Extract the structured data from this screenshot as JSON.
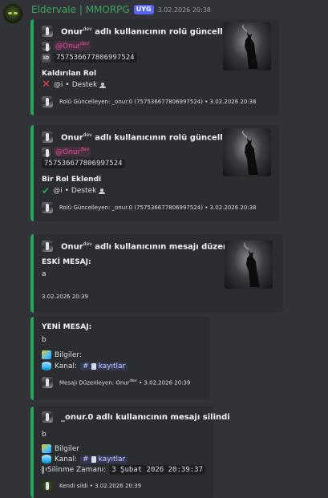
{
  "header": {
    "author": "Eldervale | MMORPG",
    "tag": "UYG",
    "timestamp": "3.02.2026 20:38"
  },
  "embed1": {
    "title": "Onur",
    "title_sup": "dev",
    "title_rest": "adlı kullanıcının rolü güncellendi",
    "mention": "@Onur",
    "mention_sup": "dev",
    "id_badge": "ID",
    "user_id": "757536677806997524",
    "field_name": "Kaldırılan Rol",
    "role_prefix": "@i",
    "role_name": "Destek",
    "footer": "Rolü Güncelleyen: _onur.0 (757536677806997524) • 3.02.2026 20:38"
  },
  "embed2": {
    "title": "Onur",
    "title_sup": "dev",
    "title_rest": "adlı kullanıcının rolü güncellendi",
    "mention": "@Onur",
    "mention_sup": "dev",
    "user_id": "757536677806997524",
    "field_name": "Bir Rol Eklendi",
    "role_prefix": "@i",
    "role_name": "Destek",
    "footer": "Rolü Güncelleyen: _onur.0 (757536677806997524) • 3.02.2026 20:38"
  },
  "embed3": {
    "title": "Onur",
    "title_sup": "dev",
    "title_rest": "adlı kullanıcının mesajı düzenlendi",
    "field_name": "ESKİ MESAJ:",
    "field_value": "a",
    "footer": "3.02.2026 20:39"
  },
  "embed4": {
    "field_name": "YENİ MESAJ:",
    "field_value": "b",
    "info_label": "Bilgiler:",
    "channel_label": "Kanal:",
    "channel_name": "kayıtlar",
    "footer_prefix": "Mesajı Düzenleyen: Onur",
    "footer_sup": "dev",
    "footer_time": "• 3.02.2026 20:39"
  },
  "embed5": {
    "title": "_onur.0 adlı kullanıcının mesajı silindi",
    "field_value": "b",
    "info_label": "Bilgiler",
    "channel_label": "Kanal:",
    "channel_name": "kayıtlar",
    "deleted_label": "Silinme Zamanı:",
    "deleted_value": "3 Şubat 2026 20:39:37",
    "footer": "Kendi sildi • 3.02.2026 20:39"
  },
  "colors": {
    "accent_green": "#23a55a",
    "author_green": "#3ba55c",
    "tag_blue": "#5865f2",
    "mention_pink": "#e64c9c"
  }
}
